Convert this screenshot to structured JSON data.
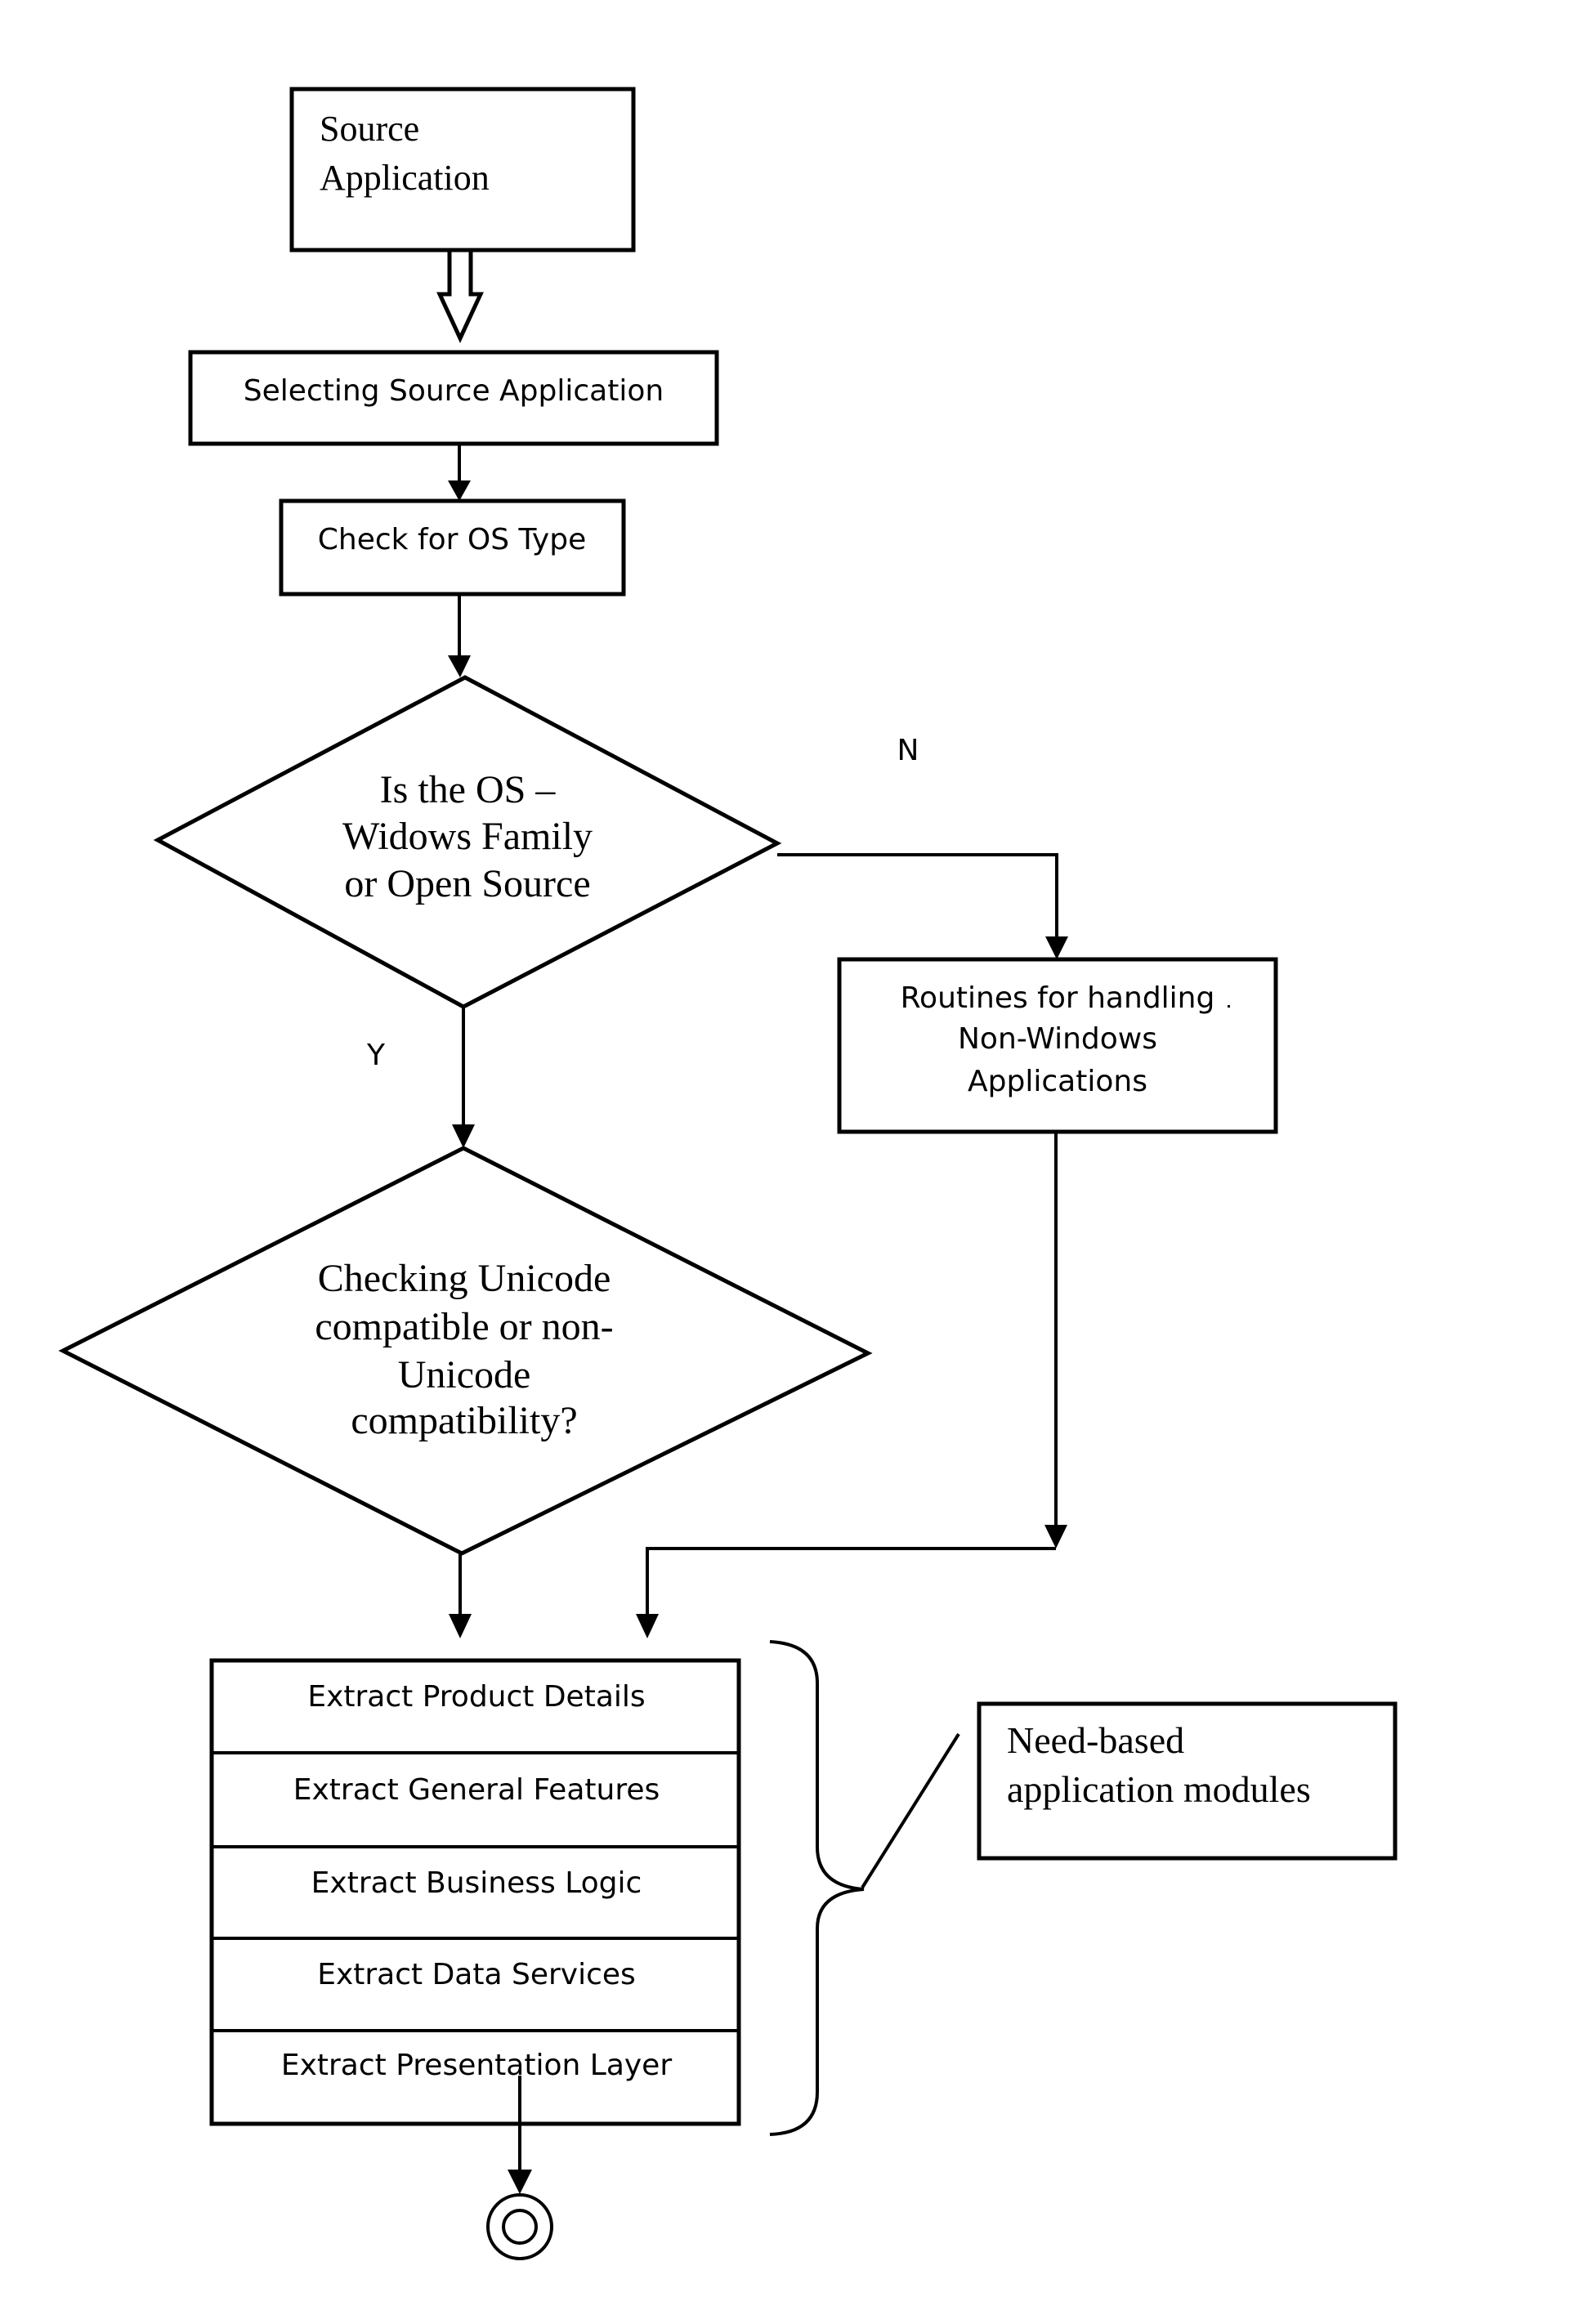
{
  "diagram": {
    "type": "flowchart",
    "nodes": {
      "source_application": {
        "lines": [
          "Source",
          "Application"
        ]
      },
      "selecting_source": {
        "label": "Selecting Source Application"
      },
      "check_os": {
        "label": "Check for OS Type"
      },
      "decision_os": {
        "lines": [
          "Is the OS –",
          "Widows Family",
          "or Open Source"
        ]
      },
      "routines_non_windows": {
        "lines": [
          "Routines for handling",
          "Non-Windows",
          "Applications"
        ]
      },
      "decision_unicode": {
        "lines": [
          "Checking Unicode",
          "compatible or non-",
          "Unicode",
          "compatibility?"
        ]
      },
      "extract_modules": [
        "Extract Product Details",
        "Extract General Features",
        "Extract Business Logic",
        "Extract Data Services",
        "Extract Presentation Layer"
      ],
      "callout": {
        "lines": [
          "Need-based",
          "application modules"
        ]
      },
      "end": {
        "symbol": "end-state"
      }
    },
    "edge_labels": {
      "no": "N",
      "yes": "Y"
    },
    "edges": [
      {
        "from": "source_application",
        "to": "selecting_source",
        "style": "hollow-arrow"
      },
      {
        "from": "selecting_source",
        "to": "check_os"
      },
      {
        "from": "check_os",
        "to": "decision_os"
      },
      {
        "from": "decision_os",
        "to": "routines_non_windows",
        "label": "N"
      },
      {
        "from": "decision_os",
        "to": "decision_unicode",
        "label": "Y"
      },
      {
        "from": "decision_unicode",
        "to": "extract_modules"
      },
      {
        "from": "routines_non_windows",
        "to": "extract_modules"
      },
      {
        "from": "extract_modules",
        "to": "end"
      }
    ]
  }
}
